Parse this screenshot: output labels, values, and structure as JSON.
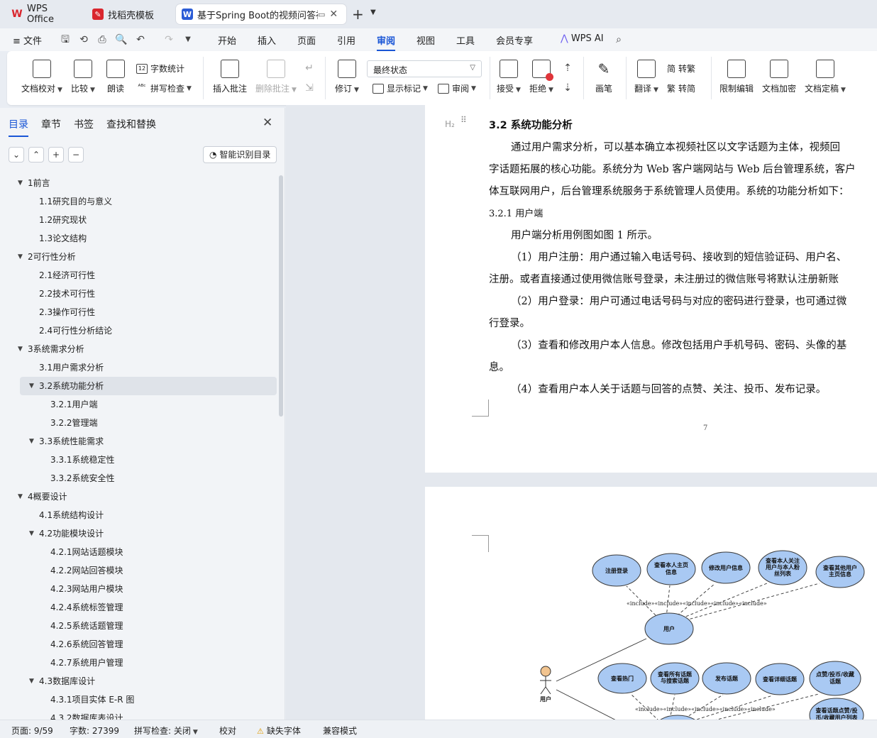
{
  "tabs": [
    {
      "label": "WPS Office",
      "icon": "wps-logo-icon",
      "color": "#d9262e"
    },
    {
      "label": "找稻壳模板",
      "icon": "docer-icon",
      "color": "#d9262e"
    },
    {
      "label": "基于Spring Boot的视频问答社",
      "icon": "word-doc-icon",
      "color": "#2b5cd6"
    }
  ],
  "menu": {
    "file": "文件",
    "items": [
      "开始",
      "插入",
      "页面",
      "引用",
      "审阅",
      "视图",
      "工具",
      "会员专享"
    ],
    "active": "审阅",
    "ai": "WPS AI"
  },
  "ribbon": {
    "doc_check": "文档校对",
    "compare": "比较",
    "read_aloud": "朗读",
    "word_count": "字数统计",
    "spell_check": "拼写检查",
    "insert_comment": "插入批注",
    "delete_comment": "删除批注",
    "track_changes": "修订",
    "status_select": "最终状态",
    "show_markup": "显示标记",
    "review": "审阅",
    "accept": "接受",
    "reject": "拒绝",
    "pen": "画笔",
    "translate": "翻译",
    "to_traditional": "转繁",
    "to_simplified": "转简",
    "restrict_edit": "限制编辑",
    "encrypt": "文档加密",
    "finalize": "文档定稿"
  },
  "nav": {
    "tabs": [
      "目录",
      "章节",
      "书签",
      "查找和替换"
    ],
    "smart_toc": "智能识别目录",
    "toc": [
      {
        "label": "1前言",
        "level": 1,
        "expanded": true
      },
      {
        "label": "1.1研究目的与意义",
        "level": 2
      },
      {
        "label": "1.2研究现状",
        "level": 2
      },
      {
        "label": "1.3论文结构",
        "level": 2
      },
      {
        "label": "2可行性分析",
        "level": 1,
        "expanded": true
      },
      {
        "label": "2.1经济可行性",
        "level": 2
      },
      {
        "label": "2.2技术可行性",
        "level": 2
      },
      {
        "label": "2.3操作可行性",
        "level": 2
      },
      {
        "label": "2.4可行性分析结论",
        "level": 2
      },
      {
        "label": "3系统需求分析",
        "level": 1,
        "expanded": true
      },
      {
        "label": "3.1用户需求分析",
        "level": 2
      },
      {
        "label": "3.2系统功能分析",
        "level": 2,
        "expanded": true,
        "selected": true
      },
      {
        "label": "3.2.1用户端",
        "level": 3
      },
      {
        "label": "3.2.2管理端",
        "level": 3
      },
      {
        "label": "3.3系统性能需求",
        "level": 2,
        "expanded": true
      },
      {
        "label": "3.3.1系统稳定性",
        "level": 3
      },
      {
        "label": "3.3.2系统安全性",
        "level": 3
      },
      {
        "label": "4概要设计",
        "level": 1,
        "expanded": true
      },
      {
        "label": "4.1系统结构设计",
        "level": 2
      },
      {
        "label": "4.2功能模块设计",
        "level": 2,
        "expanded": true
      },
      {
        "label": "4.2.1网站话题模块",
        "level": 3
      },
      {
        "label": "4.2.2网站回答模块",
        "level": 3
      },
      {
        "label": "4.2.3网站用户模块",
        "level": 3
      },
      {
        "label": "4.2.4系统标签管理",
        "level": 3
      },
      {
        "label": "4.2.5系统话题管理",
        "level": 3
      },
      {
        "label": "4.2.6系统回答管理",
        "level": 3
      },
      {
        "label": "4.2.7系统用户管理",
        "level": 3
      },
      {
        "label": "4.3数据库设计",
        "level": 2,
        "expanded": true
      },
      {
        "label": "4.3.1项目实体 E-R 图",
        "level": 3
      },
      {
        "label": "4.3.2数据库表设计",
        "level": 3
      }
    ]
  },
  "doc": {
    "heading_marker": "H₂",
    "section_title": "3.2  系统功能分析",
    "lines": [
      "通过用户需求分析，可以基本确立本视频社区以文字话题为主体，视频回",
      "字话题拓展的核心功能。系统分为 Web 客户端网站与 Web 后台管理系统，客户",
      "体互联网用户，后台管理系统服务于系统管理人员使用。系统的功能分析如下：",
      "3.2.1  用户端",
      "用户端分析用例图如图 1 所示。",
      "（1）用户注册：用户通过输入电话号码、接收到的短信验证码、用户名、",
      "注册。或者直接通过使用微信账号登录，未注册过的微信账号将默认注册新账",
      "（2）用户登录：用户可通过电话号码与对应的密码进行登录，也可通过微",
      "行登录。",
      "（3）查看和修改用户本人信息。修改包括用户手机号码、密码、头像的基",
      "息。",
      "（4）查看用户本人关于话题与回答的点赞、关注、投币、发布记录。"
    ],
    "page_number": "7"
  },
  "diagram": {
    "actor": "用户",
    "hub": "用户",
    "include_label": "«include»",
    "top_cases": [
      "注册登录",
      "查看本人主页信息",
      "修改用户信息",
      "查看本人关注用户与本人粉丝列表",
      "查看其他用户主页信息"
    ],
    "bottom_cases": [
      "查看热门",
      "查看所有话题与搜索话题",
      "发布话题",
      "查看详细话题",
      "点赞/投币/收藏话题",
      "查看话题点赞/投币/收藏用户列表"
    ]
  },
  "status": {
    "page": "页面: 9/59",
    "words": "字数: 27399",
    "spell": "拼写检查: 关闭",
    "proof": "校对",
    "missing_font": "缺失字体",
    "compat": "兼容模式"
  }
}
